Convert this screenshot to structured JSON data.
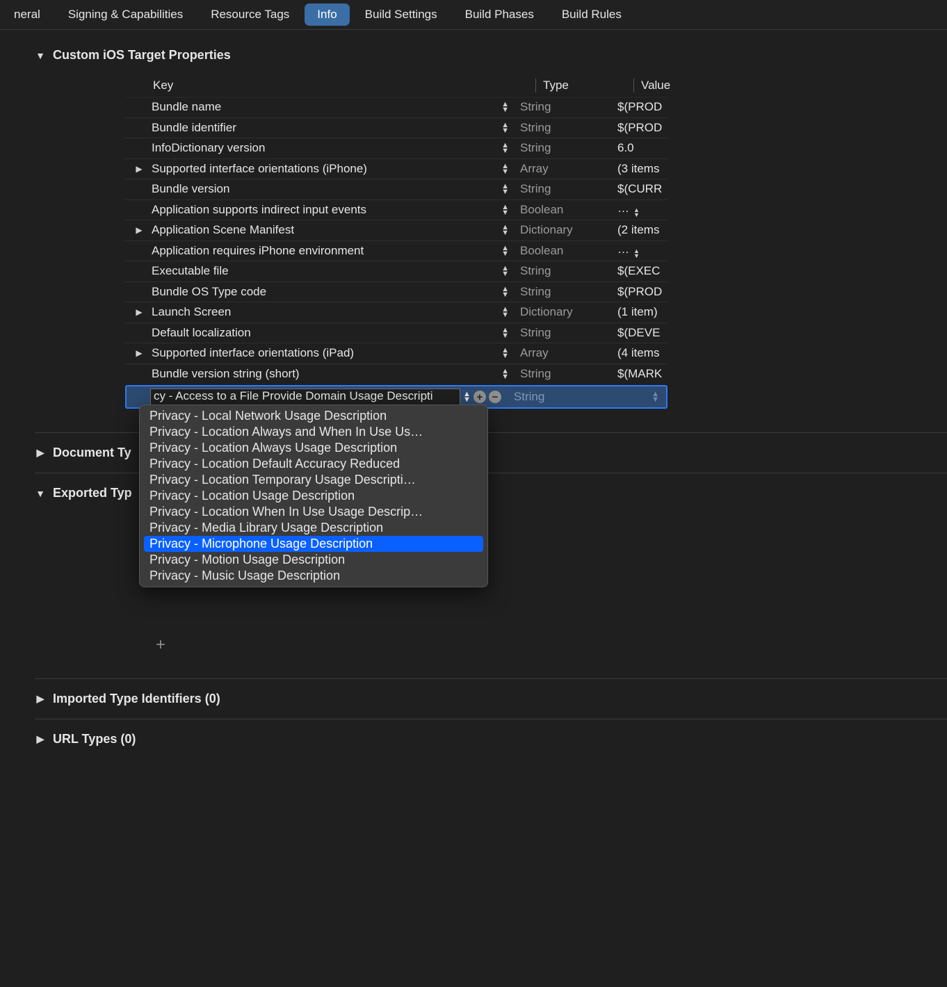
{
  "tabs": {
    "items": [
      {
        "label": "neral"
      },
      {
        "label": "Signing & Capabilities"
      },
      {
        "label": "Resource Tags"
      },
      {
        "label": "Info"
      },
      {
        "label": "Build Settings"
      },
      {
        "label": "Build Phases"
      },
      {
        "label": "Build Rules"
      }
    ],
    "active_index": 3
  },
  "section_title": "Custom iOS Target Properties",
  "columns": {
    "key": "Key",
    "type": "Type",
    "value": "Value"
  },
  "rows": [
    {
      "key": "Bundle name",
      "type": "String",
      "value": "$(PROD",
      "expandable": false
    },
    {
      "key": "Bundle identifier",
      "type": "String",
      "value": "$(PROD",
      "expandable": false
    },
    {
      "key": "InfoDictionary version",
      "type": "String",
      "value": "6.0",
      "expandable": false
    },
    {
      "key": "Supported interface orientations (iPhone)",
      "type": "Array",
      "value": "(3 items",
      "expandable": true,
      "muted": true
    },
    {
      "key": "Bundle version",
      "type": "String",
      "value": "$(CURR",
      "expandable": false
    },
    {
      "key": "Application supports indirect input events",
      "type": "Boolean",
      "value": "…",
      "expandable": false,
      "bool": true
    },
    {
      "key": "Application Scene Manifest",
      "type": "Dictionary",
      "value": "(2 items",
      "expandable": true,
      "muted": true
    },
    {
      "key": "Application requires iPhone environment",
      "type": "Boolean",
      "value": "…",
      "expandable": false,
      "bool": true
    },
    {
      "key": "Executable file",
      "type": "String",
      "value": "$(EXEC",
      "expandable": false
    },
    {
      "key": "Bundle OS Type code",
      "type": "String",
      "value": "$(PROD",
      "expandable": false
    },
    {
      "key": "Launch Screen",
      "type": "Dictionary",
      "value": "(1 item)",
      "expandable": true,
      "muted": true
    },
    {
      "key": "Default localization",
      "type": "String",
      "value": "$(DEVE",
      "expandable": false
    },
    {
      "key": "Supported interface orientations (iPad)",
      "type": "Array",
      "value": "(4 items",
      "expandable": true,
      "muted": true
    },
    {
      "key": "Bundle version string (short)",
      "type": "String",
      "value": "$(MARK",
      "expandable": false
    }
  ],
  "editing_row": {
    "input_value": "cy - Access to a File Provide Domain Usage Descripti",
    "type": "String"
  },
  "dropdown": {
    "items": [
      "Privacy - Local Network Usage Description",
      "Privacy - Location Always and When In Use Us…",
      "Privacy - Location Always Usage Description",
      "Privacy - Location Default Accuracy Reduced",
      "Privacy - Location Temporary Usage Descripti…",
      "Privacy - Location Usage Description",
      "Privacy - Location When In Use Usage Descrip…",
      "Privacy - Media Library Usage Description",
      "Privacy - Microphone Usage Description",
      "Privacy - Motion Usage Description",
      "Privacy - Music Usage Description"
    ],
    "highlight_index": 8
  },
  "lower_sections": [
    {
      "label": "Document Ty",
      "disc": "right"
    },
    {
      "label": "Exported Typ",
      "disc": "down"
    },
    {
      "label": "Imported Type Identifiers (0)",
      "disc": "right"
    },
    {
      "label": "URL Types (0)",
      "disc": "right"
    }
  ],
  "add_glyph": "+"
}
